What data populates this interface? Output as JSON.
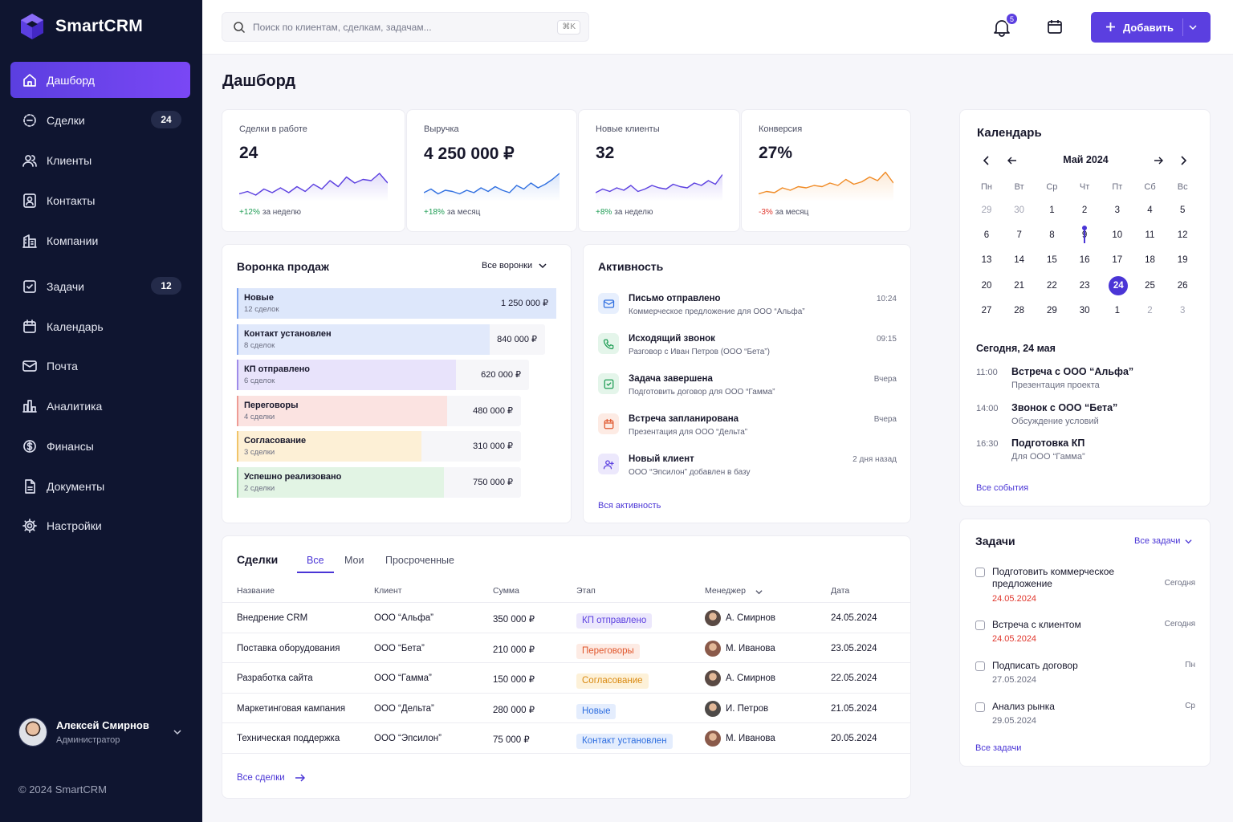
{
  "app": {
    "name": "SmartCRM",
    "copyright": "© 2024 SmartCRM"
  },
  "sidebar": {
    "items": [
      {
        "label": "Дашборд",
        "icon": "home-icon",
        "active": true
      },
      {
        "label": "Сделки",
        "icon": "deals-icon",
        "badge": "24"
      },
      {
        "label": "Клиенты",
        "icon": "users-icon"
      },
      {
        "label": "Контакты",
        "icon": "contact-card-icon"
      },
      {
        "label": "Компании",
        "icon": "building-icon"
      },
      {
        "label": "Задачи",
        "icon": "checkbox-icon",
        "badge": "12"
      },
      {
        "label": "Календарь",
        "icon": "calendar-icon"
      },
      {
        "label": "Почта",
        "icon": "mail-icon"
      },
      {
        "label": "Аналитика",
        "icon": "chart-icon"
      },
      {
        "label": "Финансы",
        "icon": "coin-icon"
      },
      {
        "label": "Документы",
        "icon": "document-icon"
      },
      {
        "label": "Настройки",
        "icon": "gear-icon"
      }
    ],
    "user": {
      "name": "Алексей Смирнов",
      "role": "Администратор"
    }
  },
  "topbar": {
    "search_placeholder": "Поиск по клиентам, сделкам, задачам...",
    "shortcut": "⌘K",
    "notifications": "5",
    "add_label": "Добавить"
  },
  "page_title": "Дашборд",
  "kpis": [
    {
      "label": "Сделки в работе",
      "value": "24",
      "delta": "+12%",
      "period": "за неделю",
      "color": "#5b3fe0",
      "delta_color": "#1f9d55"
    },
    {
      "label": "Выручка",
      "value": "4 250 000 ₽",
      "delta": "+18%",
      "period": "за месяц",
      "color": "#2f6fe0",
      "delta_color": "#1f9d55"
    },
    {
      "label": "Новые клиенты",
      "value": "32",
      "delta": "+8%",
      "period": "за неделю",
      "color": "#5b3fe0",
      "delta_color": "#1f9d55"
    },
    {
      "label": "Конверсия",
      "value": "27%",
      "delta": "-3%",
      "period": "за месяц",
      "color": "#f08a24",
      "delta_color": "#e0362c"
    }
  ],
  "funnel": {
    "title": "Воронка продаж",
    "filter": "Все воронки",
    "stages": [
      {
        "name": "Новые",
        "count": "12 сделок",
        "amount": "1 250 000 ₽",
        "share": 1.0,
        "color": "#dde7fb",
        "edge": "#7ea4ef"
      },
      {
        "name": "Контакт установлен",
        "count": "8 сделок",
        "amount": "840 000 ₽",
        "share": 0.82,
        "color": "#e1e9fb",
        "edge": "#8aa9ee"
      },
      {
        "name": "КП отправлено",
        "count": "6 сделок",
        "amount": "620 000 ₽",
        "share": 0.75,
        "color": "#e8e3fb",
        "edge": "#9f8ce9"
      },
      {
        "name": "Переговоры",
        "count": "4 сделки",
        "amount": "480 000 ₽",
        "share": 0.74,
        "color": "#fbe3e1",
        "edge": "#ee9c95"
      },
      {
        "name": "Согласование",
        "count": "3 сделки",
        "amount": "310 000 ₽",
        "share": 0.65,
        "color": "#fdf0d6",
        "edge": "#f1c469"
      },
      {
        "name": "Успешно реализовано",
        "count": "2 сделки",
        "amount": "750 000 ₽",
        "share": 0.73,
        "color": "#e2f4e4",
        "edge": "#8dd198"
      }
    ]
  },
  "activity": {
    "title": "Активность",
    "items": [
      {
        "icon": "mail-icon",
        "title": "Письмо отправлено",
        "desc": "Коммерческое предложение для ООО “Альфа”",
        "time": "10:24",
        "color": "#2f6fe0",
        "bg": "#e7effd"
      },
      {
        "icon": "phone-icon",
        "title": "Исходящий звонок",
        "desc": "Разговор с Иван Петров (ООО “Бета”)",
        "time": "09:15",
        "color": "#1f9d55",
        "bg": "#e4f5ea"
      },
      {
        "icon": "task-done-icon",
        "title": "Задача завершена",
        "desc": "Подготовить договор для ООО “Гамма”",
        "time": "Вчера",
        "color": "#1f9d55",
        "bg": "#e4f5ea"
      },
      {
        "icon": "calendar-icon",
        "title": "Встреча запланирована",
        "desc": "Презентация для ООО “Дельта”",
        "time": "Вчера",
        "color": "#e0562c",
        "bg": "#fdebe4"
      },
      {
        "icon": "user-add-icon",
        "title": "Новый клиент",
        "desc": "ООО “Эпсилон” добавлен в базу",
        "time": "2 дня назад",
        "color": "#5b3fe0",
        "bg": "#ece8fc"
      }
    ],
    "link": "Вся активность"
  },
  "deals": {
    "title": "Сделки",
    "tabs": [
      "Все",
      "Мои",
      "Просроченные"
    ],
    "columns": [
      "Название",
      "Клиент",
      "Сумма",
      "Этап",
      "Менеджер",
      "Дата"
    ],
    "rows": [
      {
        "name": "Внедрение CRM",
        "client": "ООО “Альфа”",
        "sum": "350 000 ₽",
        "stage": "КП отправлено",
        "stage_color": "#5b3fe0",
        "stage_bg": "#ece8fc",
        "manager": "А. Смирнов",
        "date": "24.05.2024"
      },
      {
        "name": "Поставка оборудования",
        "client": "ООО “Бета”",
        "sum": "210 000 ₽",
        "stage": "Переговоры",
        "stage_color": "#e0562c",
        "stage_bg": "#fdebe4",
        "manager": "М. Иванова",
        "date": "23.05.2024"
      },
      {
        "name": "Разработка сайта",
        "client": "ООО “Гамма”",
        "sum": "150 000 ₽",
        "stage": "Согласование",
        "stage_color": "#d98a12",
        "stage_bg": "#fdf1d8",
        "manager": "А. Смирнов",
        "date": "22.05.2024"
      },
      {
        "name": "Маркетинговая кампания",
        "client": "ООО “Дельта”",
        "sum": "280 000 ₽",
        "stage": "Новые",
        "stage_color": "#2f6fe0",
        "stage_bg": "#e4edfd",
        "manager": "И. Петров",
        "date": "21.05.2024"
      },
      {
        "name": "Техническая поддержка",
        "client": "ООО “Эпсилон”",
        "sum": "75 000 ₽",
        "stage": "Контакт установлен",
        "stage_color": "#2f6fe0",
        "stage_bg": "#e4edfd",
        "manager": "М. Иванова",
        "date": "20.05.2024"
      }
    ],
    "link": "Все сделки"
  },
  "calendar": {
    "title": "Календарь",
    "month": "Май 2024",
    "weekdays": [
      "Пн",
      "Вт",
      "Ср",
      "Чт",
      "Пт",
      "Сб",
      "Вс"
    ],
    "weeks": [
      [
        "29",
        "30",
        "1",
        "2",
        "3",
        "4",
        "5"
      ],
      [
        "6",
        "7",
        "8",
        "9",
        "10",
        "11",
        "12"
      ],
      [
        "13",
        "14",
        "15",
        "16",
        "17",
        "18",
        "19"
      ],
      [
        "20",
        "21",
        "22",
        "23",
        "24",
        "25",
        "26"
      ],
      [
        "27",
        "28",
        "29",
        "30",
        "1",
        "2",
        "3"
      ]
    ],
    "today_heading": "Сегодня, 24 мая",
    "events": [
      {
        "time": "11:00",
        "title": "Встреча с ООО “Альфа”",
        "desc": "Презентация проекта"
      },
      {
        "time": "14:00",
        "title": "Звонок с ООО “Бета”",
        "desc": "Обсуждение условий"
      },
      {
        "time": "16:30",
        "title": "Подготовка КП",
        "desc": "Для ООО “Гамма”"
      }
    ],
    "link": "Все события"
  },
  "tasks": {
    "title": "Задачи",
    "filter": "Все задачи",
    "items": [
      {
        "title": "Подготовить коммерческое предложение",
        "date": "24.05.2024",
        "due": "Сегодня",
        "overdue": true
      },
      {
        "title": "Встреча с клиентом",
        "date": "24.05.2024",
        "due": "Сегодня",
        "overdue": true
      },
      {
        "title": "Подписать договор",
        "date": "27.05.2024",
        "due": "Пн",
        "overdue": false
      },
      {
        "title": "Анализ рынка",
        "date": "29.05.2024",
        "due": "Ср",
        "overdue": false
      }
    ],
    "link": "Все задачи"
  },
  "colors": {
    "accent": "#5b3fe0",
    "sidebar": "#0f1530",
    "link": "#4a35d6",
    "danger": "#e0362c"
  }
}
